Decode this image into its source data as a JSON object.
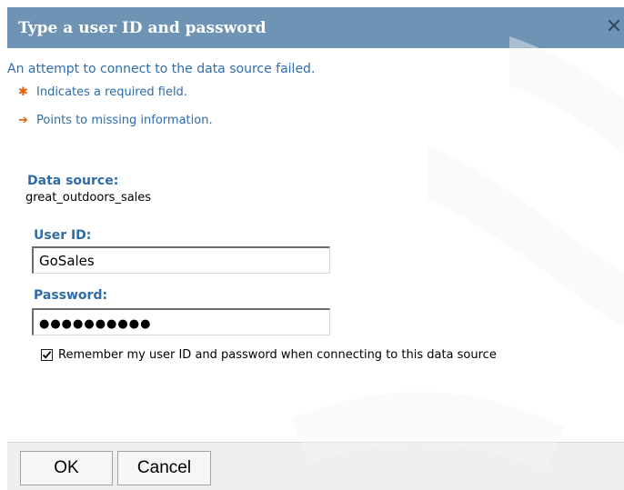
{
  "dialog": {
    "title": "Type a user ID and password",
    "close_icon": "close-icon"
  },
  "messages": {
    "error": "An attempt to connect to the data source failed.",
    "required_legend": "Indicates a required field.",
    "missing_legend": "Points to missing information.",
    "required_glyph": "✱",
    "missing_glyph": "➔"
  },
  "data_source": {
    "label": "Data source:",
    "value": "great_outdoors_sales"
  },
  "user_id": {
    "label": "User ID:",
    "value": "GoSales"
  },
  "password": {
    "label": "Password:",
    "masked_value": "●●●●●●●●●●"
  },
  "remember": {
    "label": "Remember my user ID and password when connecting to this data source",
    "checked": true
  },
  "buttons": {
    "ok": "OK",
    "cancel": "Cancel"
  },
  "colors": {
    "title_bar": "#6e93b4",
    "label_blue": "#2f6ca8",
    "marker_orange": "#e06010"
  }
}
